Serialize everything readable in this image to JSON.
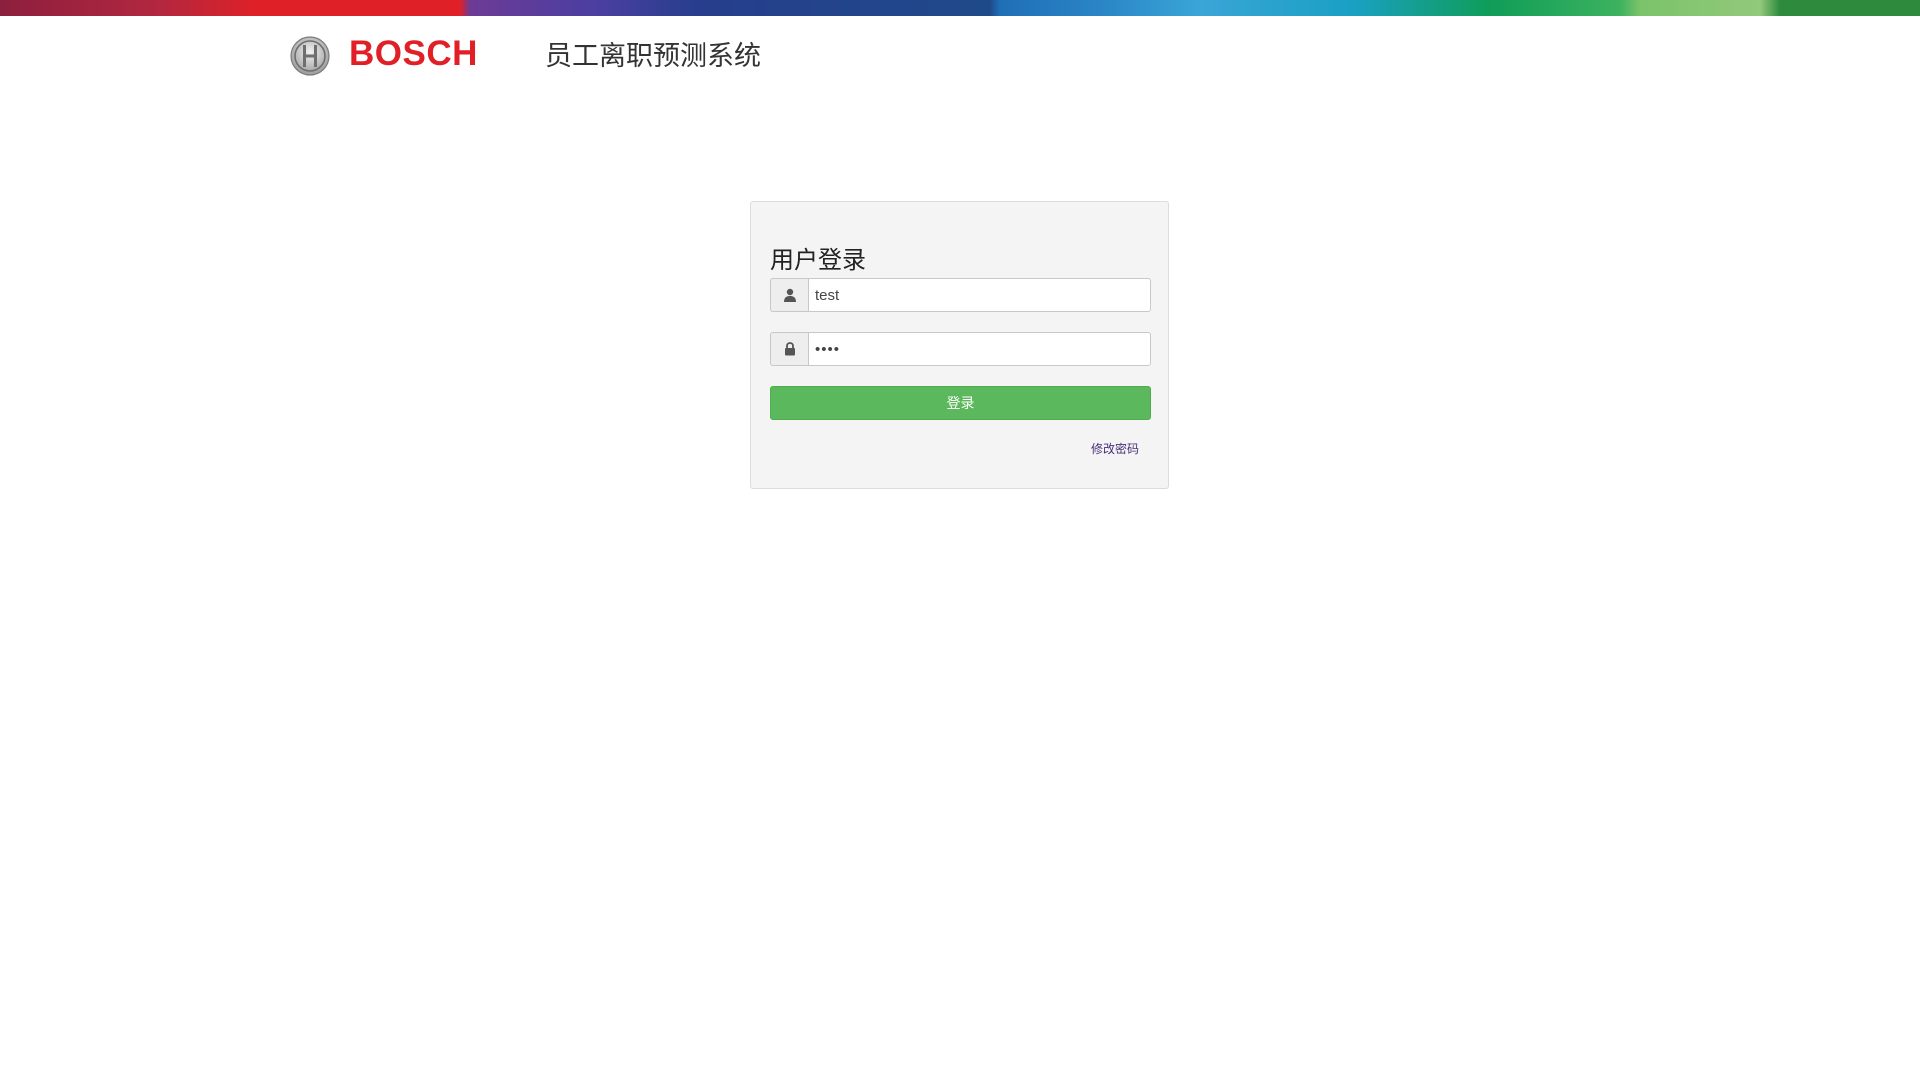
{
  "brand": {
    "name": "BOSCH",
    "accent_color": "#e11f26",
    "strip_colors": [
      "#8c1f3e",
      "#e02027",
      "#6c3b96",
      "#263e8c",
      "#1f6fb6",
      "#3aa5d6",
      "#0f9d58",
      "#92c97b",
      "#2e8b3d"
    ]
  },
  "header": {
    "app_title": "员工离职预测系统"
  },
  "login": {
    "title": "用户登录",
    "username": {
      "value": "test",
      "icon": "user-icon"
    },
    "password": {
      "value": "••••",
      "icon": "lock-icon"
    },
    "submit_label": "登录",
    "submit_color": "#5cb85c",
    "change_password_label": "修改密码"
  }
}
